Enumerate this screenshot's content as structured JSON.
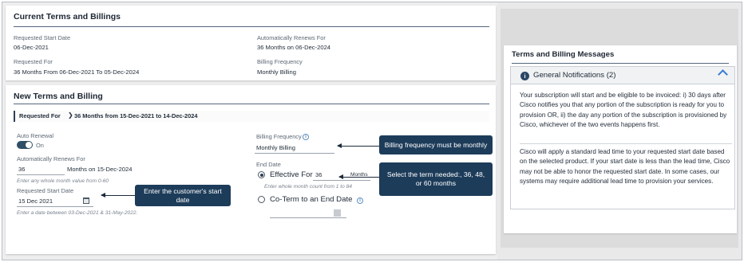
{
  "current": {
    "title": "Current Terms and Billings",
    "start_label": "Requested Start Date",
    "start_value": "06-Dec-2021",
    "renews_label": "Automatically Renews For",
    "renews_value": "36 Months on 06-Dec-2024",
    "for_label": "Requested For",
    "for_value": "36 Months From 06-Dec-2021 To 05-Dec-2024",
    "freq_label": "Billing Frequency",
    "freq_value": "Monthly Billing"
  },
  "new_terms": {
    "title": "New Terms and Billing",
    "requested_for_label": "Requested For",
    "requested_for_chevron": "❯",
    "requested_for_value": "36 Months from 15-Dec-2021 to 14-Dec-2024",
    "auto_renewal_label": "Auto Renewal",
    "auto_renewal_state": "On",
    "renews_label": "Automatically Renews For",
    "renews_months": "36",
    "renews_suffix": "Months on 15-Dec-2024",
    "renews_hint": "Enter any whole month value from 0-60",
    "start_label": "Requested Start Date",
    "start_value": "15 Dec 2021",
    "start_hint": "Enter a date between 03-Dec-2021 & 31-May-2022.",
    "freq_label": "Billing Frequency",
    "freq_value": "Monthly Billing",
    "end_date_label": "End Date",
    "effective_label": "Effective For",
    "effective_value": "36",
    "months_label": "Months",
    "effective_hint": "Enter whole month count from 1 to 84",
    "coterm_label": "Co-Term to an End Date"
  },
  "callouts": {
    "billing": "Billing frequency must be monthly",
    "term": "Select the term needed:, 36, 48, or 60 months",
    "start": "Enter the customer's start date"
  },
  "messages": {
    "title": "Terms and Billing Messages",
    "notif_title": "General Notifications (2)",
    "notif_icon_glyph": "i",
    "para1": "Your subscription will start and be eligible to be invoiced: i) 30 days after Cisco notifies you that any portion of the subscription is ready for you to provision OR, ii) the day any portion of the subscription is provisioned by Cisco, whichever of the two events happens first.",
    "para2": "Cisco will apply a standard lead time to your requested start date based on the selected product. If your start date is less than the lead time, Cisco may not be able to honor the requested start date. In some cases, our systems may require additional lead time to provision your services."
  },
  "icons": {
    "info": "info-icon",
    "calendar": "calendar-icon",
    "collapse": "chevron-up-icon"
  },
  "colors": {
    "callout_bg": "#1d3c5a",
    "toggle_on": "#2f4f66",
    "accent_blue": "#3b7bd0"
  }
}
